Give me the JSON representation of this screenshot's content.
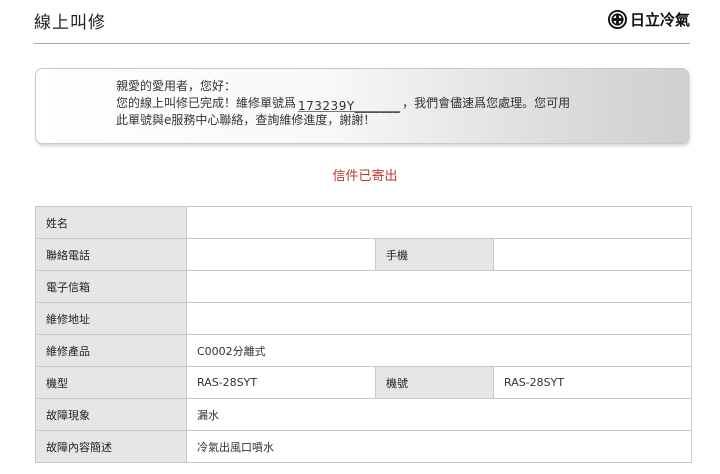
{
  "header": {
    "title": "線上叫修",
    "brand": "日立冷氣"
  },
  "notice": {
    "line1": "親愛的愛用者，您好：",
    "line2_pre": "您的線上叫修已完成！維修單號爲",
    "ticket_number": "173239Y_______",
    "line2_post": "，我們會儘速爲您處理。您可用",
    "line3": "此單號與e服務中心聯絡，查詢維修進度，謝謝！"
  },
  "status": {
    "message": "信件已寄出"
  },
  "form": {
    "name_label": "姓名",
    "name_value": "",
    "phone_label": "聯絡電話",
    "phone_value": "",
    "mobile_label": "手機",
    "mobile_value": "",
    "email_label": "電子信箱",
    "email_value": "",
    "address_label": "維修地址",
    "address_value": "",
    "product_label": "維修產品",
    "product_value": "C0002分離式",
    "model_label": "機型",
    "model_value": "RAS-28SYT",
    "model_no_label": "機號",
    "model_no_value": "RAS-28SYT",
    "symptom_label": "故障現象",
    "symptom_value": "漏水",
    "description_label": "故障內容簡述",
    "description_value": "冷氣出風口噴水"
  },
  "colors": {
    "status_red": "#c0392b",
    "label_bg": "#e6e6e6",
    "border": "#c8c8c8"
  }
}
